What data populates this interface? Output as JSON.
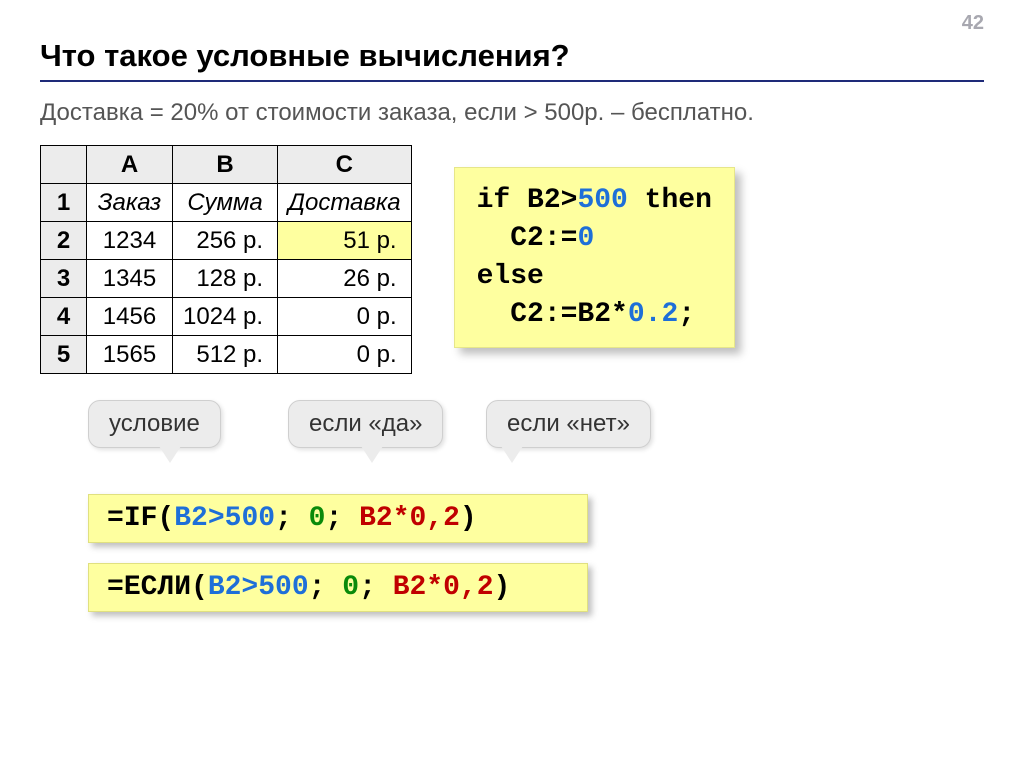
{
  "page_number": "42",
  "title": "Что такое условные вычисления?",
  "description": "Доставка = 20% от стоимости заказа, если > 500р. – бесплатно.",
  "table": {
    "columns": [
      "A",
      "B",
      "C"
    ],
    "header_row": [
      "Заказ",
      "Сумма",
      "Доставка"
    ],
    "rows": [
      {
        "n": "2",
        "a": "1234",
        "b": "256 р.",
        "c": "51 р.",
        "hl": true
      },
      {
        "n": "3",
        "a": "1345",
        "b": "128 р.",
        "c": "26 р.",
        "hl": false
      },
      {
        "n": "4",
        "a": "1456",
        "b": "1024 р.",
        "c": "0 р.",
        "hl": false
      },
      {
        "n": "5",
        "a": "1565",
        "b": "512 р.",
        "c": "0 р.",
        "hl": false
      }
    ]
  },
  "pseudocode": {
    "line1_pre": "if B2>",
    "line1_num": "500",
    "line1_post": " then",
    "line2_pre": "  C2:=",
    "line2_val": "0",
    "line3": "else",
    "line4_pre": "  C2:=B2*",
    "line4_val": "0.2",
    "line4_post": ";"
  },
  "callouts": {
    "cond": "условие",
    "yes": "если «да»",
    "no": "если «нет»"
  },
  "formula_if": {
    "eq": "=",
    "fn": "IF(",
    "ref": "B2>500",
    "sep1": "; ",
    "zero": "0",
    "sep2": "; ",
    "expr": "B2*0,2",
    "close": ")"
  },
  "formula_esli": {
    "eq": "=",
    "fn": "ЕСЛИ(",
    "ref": "B2>500",
    "sep1": "; ",
    "zero": "0",
    "sep2": "; ",
    "expr": "B2*0,2",
    "close": ")"
  },
  "chart_data": {
    "type": "table",
    "columns": [
      "Заказ",
      "Сумма",
      "Доставка"
    ],
    "rows": [
      [
        "1234",
        "256 р.",
        "51 р."
      ],
      [
        "1345",
        "128 р.",
        "26 р."
      ],
      [
        "1456",
        "1024 р.",
        "0 р."
      ],
      [
        "1565",
        "512 р.",
        "0 р."
      ]
    ]
  }
}
